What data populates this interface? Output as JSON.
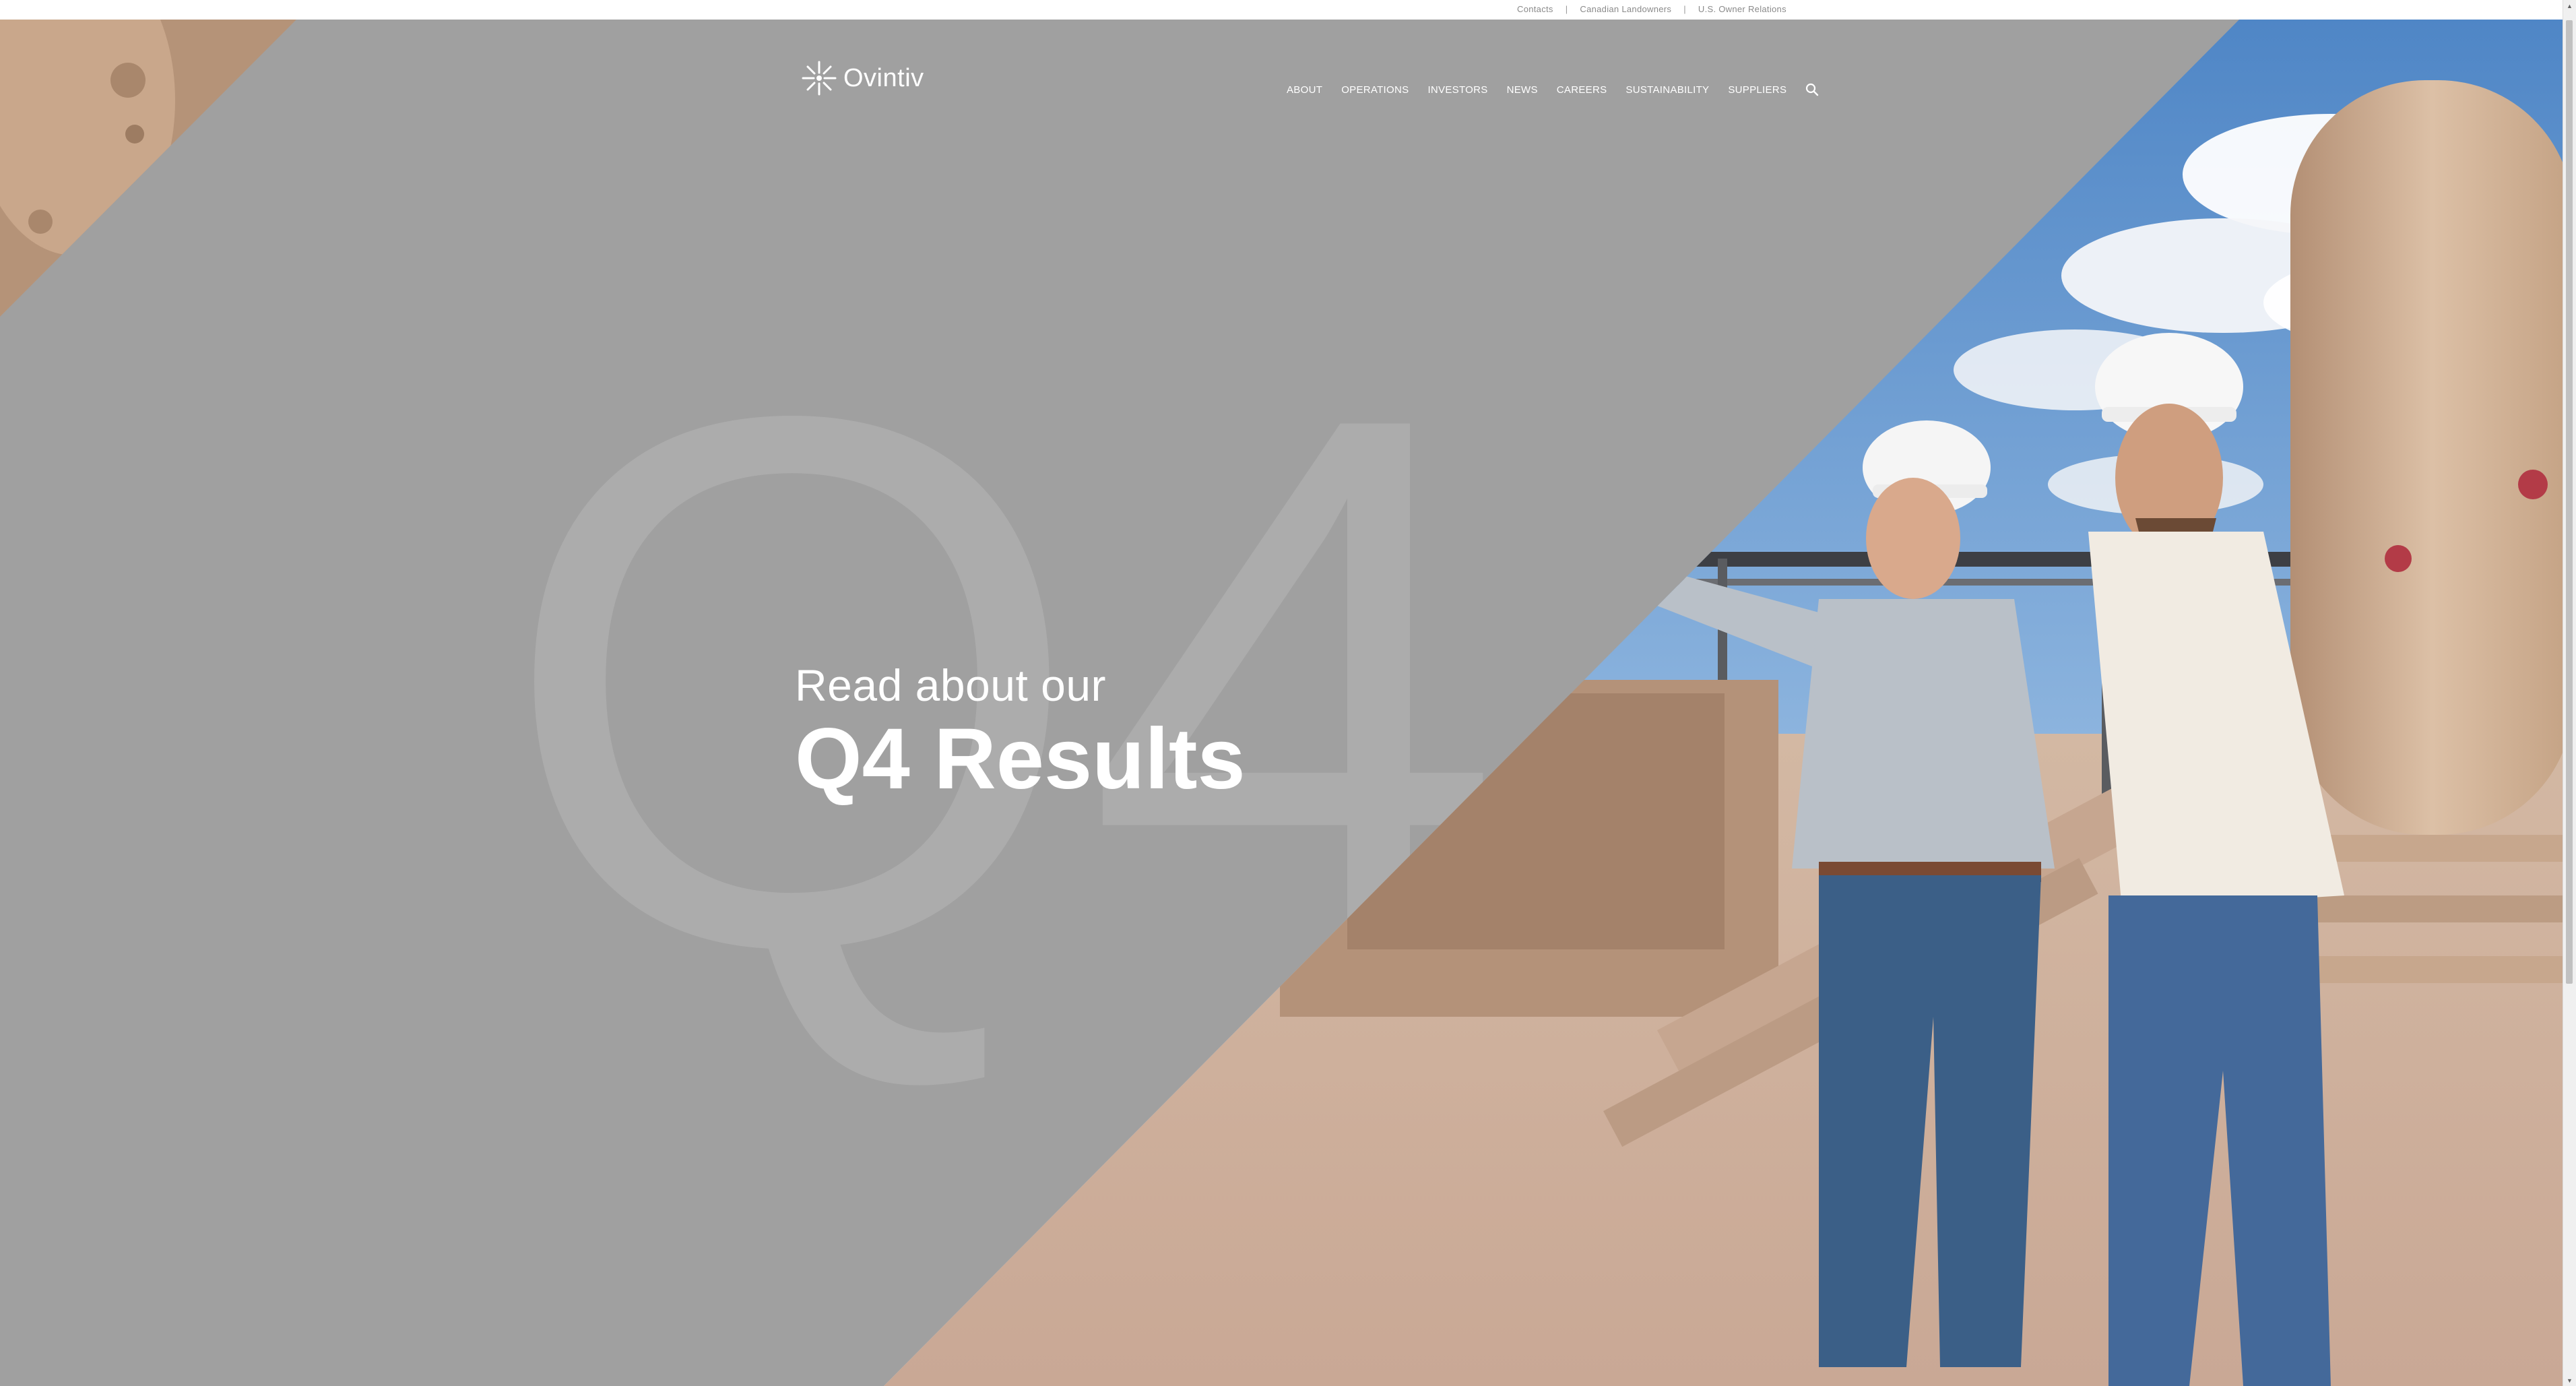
{
  "utility_links": [
    {
      "label": "Contacts"
    },
    {
      "label": "Canadian Landowners"
    },
    {
      "label": "U.S. Owner Relations"
    }
  ],
  "utility_separator": "|",
  "brand": {
    "name": "Ovintiv",
    "logo_icon": "ovintiv-star-icon"
  },
  "nav": {
    "items": [
      {
        "label": "ABOUT"
      },
      {
        "label": "OPERATIONS"
      },
      {
        "label": "INVESTORS"
      },
      {
        "label": "NEWS"
      },
      {
        "label": "CAREERS"
      },
      {
        "label": "SUSTAINABILITY"
      },
      {
        "label": "SUPPLIERS"
      }
    ],
    "search_icon": "search-icon"
  },
  "hero": {
    "watermark": "Q4",
    "subheading": "Read about our",
    "heading": "Q4 Results",
    "photo": "two-workers-in-hard-hats-at-oil-facility"
  },
  "colors": {
    "hero_gray": "#a0a0a0",
    "watermark_gray": "#acacac",
    "text_white": "#ffffff",
    "sky_blue": "#6f9fd3",
    "equipment_tan": "#c8a68c"
  }
}
